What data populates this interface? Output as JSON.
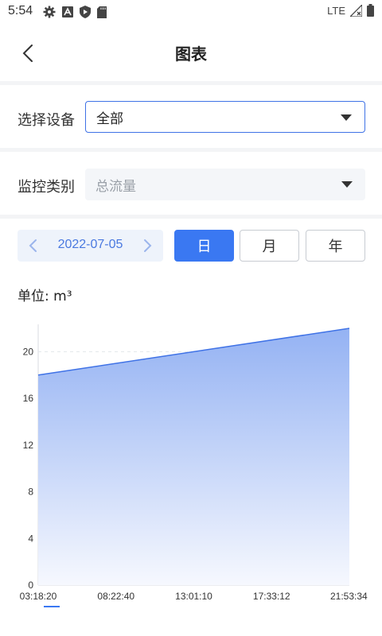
{
  "status_bar": {
    "time": "5:54",
    "network": "LTE",
    "icons": [
      "gear-icon",
      "font-icon",
      "shield-icon",
      "sd-card-icon",
      "signal-icon",
      "battery-icon"
    ]
  },
  "header": {
    "title": "图表",
    "back_icon": "chevron-left-icon"
  },
  "filters": {
    "device_label": "选择设备",
    "device_value": "全部",
    "category_label": "监控类别",
    "category_placeholder": "总流量"
  },
  "date_picker": {
    "date": "2022-07-05"
  },
  "period": {
    "day": "日",
    "month": "月",
    "year": "年",
    "selected": "day"
  },
  "colors": {
    "accent": "#3a78f2",
    "line": "#3f72e6",
    "area_top": "#94b2f3",
    "area_bottom": "#f6f8fe"
  },
  "chart_data": {
    "type": "area",
    "unit_label": "单位: m³",
    "x": [
      "03:18:20",
      "21:53:34"
    ],
    "x_tick_labels": [
      "03:18:20",
      "08:22:40",
      "13:01:10",
      "17:33:12",
      "21:53:34"
    ],
    "values": [
      18,
      22
    ],
    "ylim": [
      0,
      22
    ],
    "y_ticks": [
      0,
      4,
      8,
      12,
      16,
      20
    ],
    "grid": "dashed at 20"
  }
}
